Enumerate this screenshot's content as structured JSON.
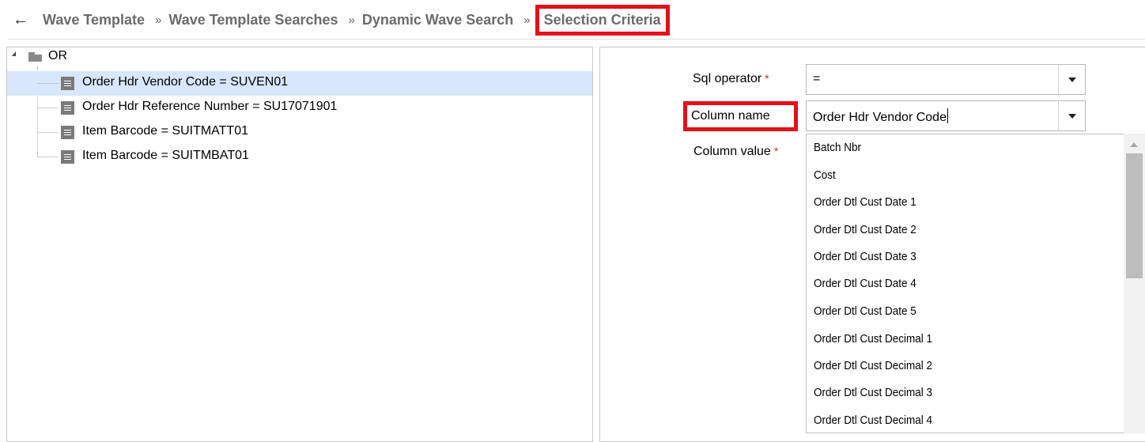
{
  "breadcrumb": {
    "back_icon": "arrow-left-icon",
    "separator": "»",
    "items": [
      "Wave Template",
      "Wave Template Searches",
      "Dynamic Wave Search"
    ],
    "current": "Selection Criteria"
  },
  "tree": {
    "root_label": "OR",
    "nodes": [
      "Order Hdr Vendor Code = SUVEN01",
      "Order Hdr Reference Number = SU17071901",
      "Item Barcode = SUITMATT01",
      "Item Barcode = SUITMBAT01"
    ],
    "selected_index": 0
  },
  "form": {
    "sql_operator_label": "Sql operator",
    "sql_operator_value": "=",
    "column_name_label": "Column name",
    "column_name_value": "Order Hdr Vendor Code",
    "column_value_label": "Column value",
    "required_mark": "*"
  },
  "dropdown": {
    "options": [
      "Batch Nbr",
      "Cost",
      "Order Dtl Cust Date 1",
      "Order Dtl Cust Date 2",
      "Order Dtl Cust Date 3",
      "Order Dtl Cust Date 4",
      "Order Dtl Cust Date 5",
      "Order Dtl Cust Decimal 1",
      "Order Dtl Cust Decimal 2",
      "Order Dtl Cust Decimal 3",
      "Order Dtl Cust Decimal 4"
    ]
  },
  "colors": {
    "highlight_border": "#e2101a",
    "selected_row": "#d8e7fb",
    "required": "#d9222a"
  }
}
